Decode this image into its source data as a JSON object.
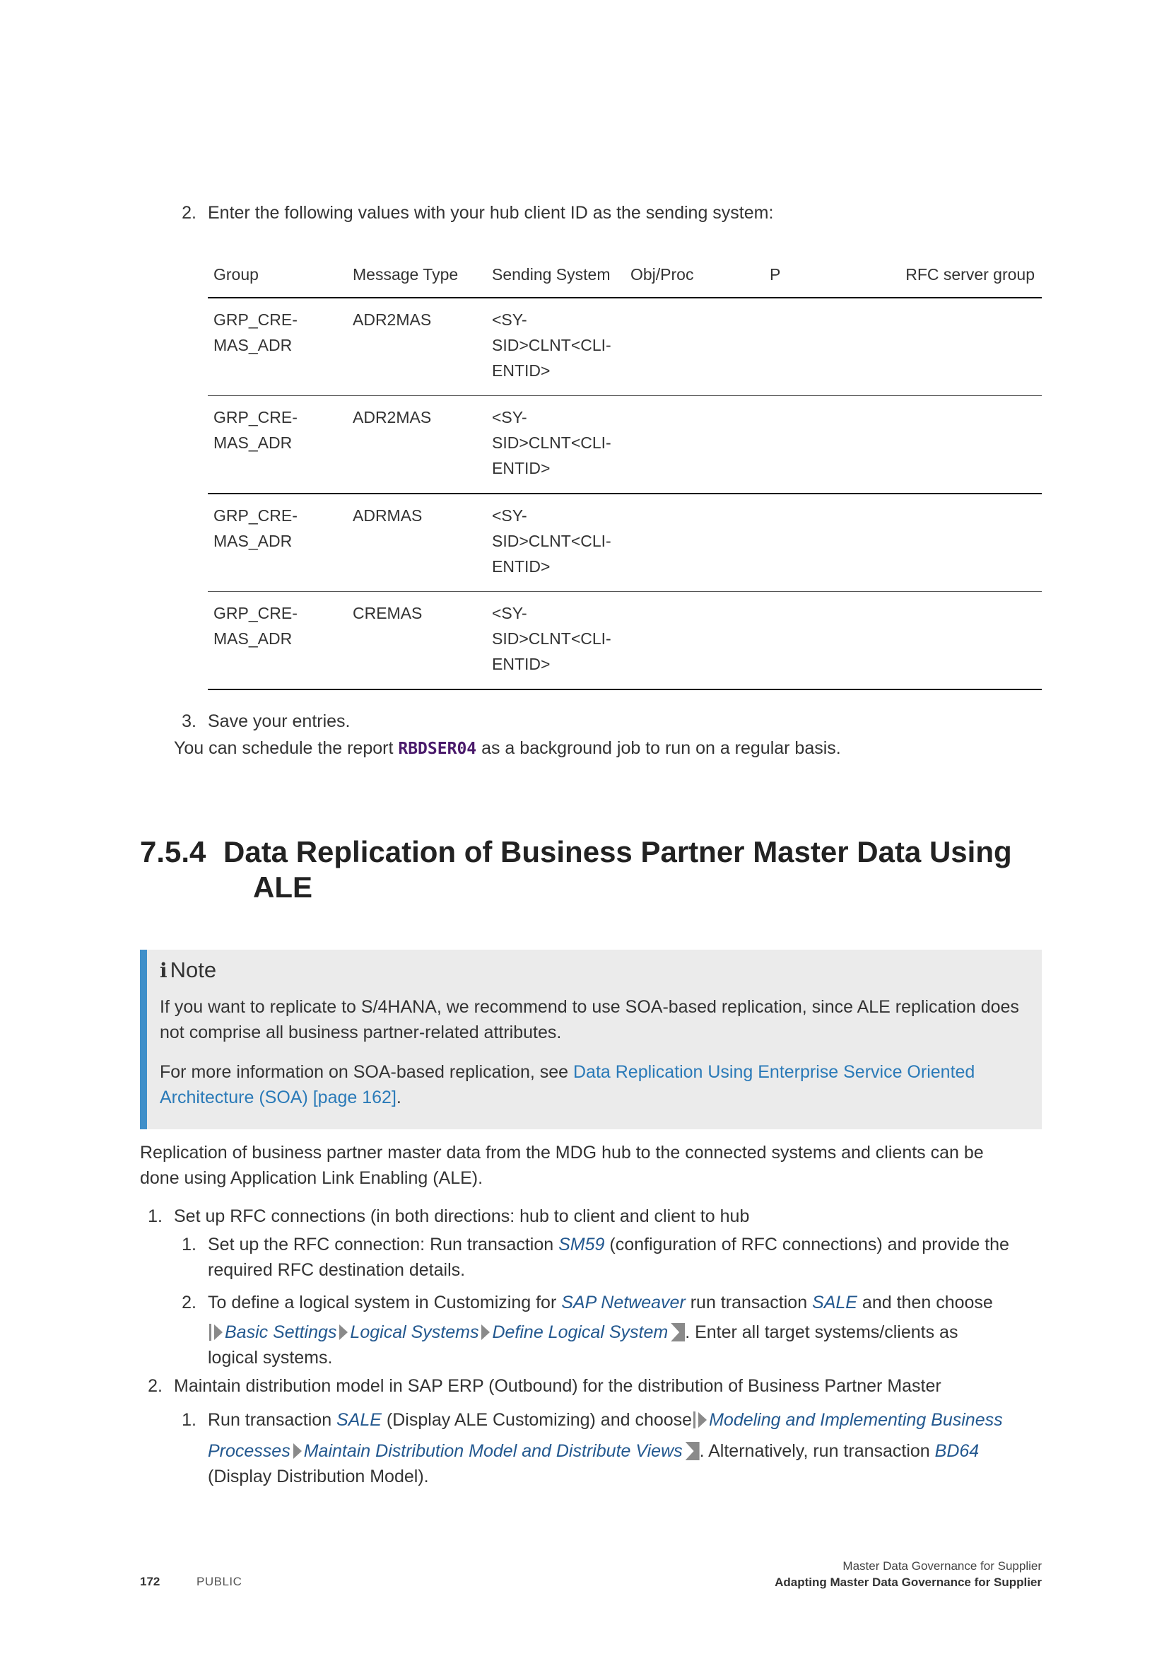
{
  "step2_top": {
    "num": "2.",
    "text": "Enter the following values with your hub client ID as the sending system:"
  },
  "table": {
    "headers": [
      "Group",
      "Message Type",
      "Sending System",
      "Obj/Proc",
      "P",
      "RFC server group"
    ],
    "rows": [
      {
        "group": [
          "GRP_CRE-",
          "MAS_ADR"
        ],
        "message_type": "ADR2MAS",
        "sending_system": [
          "<SY-",
          "SID>CLNT<CLI-",
          "ENTID>"
        ]
      },
      {
        "group": [
          "GRP_CRE-",
          "MAS_ADR"
        ],
        "message_type": "ADR2MAS",
        "sending_system": [
          "<SY-",
          "SID>CLNT<CLI-",
          "ENTID>"
        ]
      },
      {
        "group": [
          "GRP_CRE-",
          "MAS_ADR"
        ],
        "message_type": "ADRMAS",
        "sending_system": [
          "<SY-",
          "SID>CLNT<CLI-",
          "ENTID>"
        ]
      },
      {
        "group": [
          "GRP_CRE-",
          "MAS_ADR"
        ],
        "message_type": "CREMAS",
        "sending_system": [
          "<SY-",
          "SID>CLNT<CLI-",
          "ENTID>"
        ]
      }
    ]
  },
  "step3": {
    "num": "3.",
    "text": "Save your entries."
  },
  "schedule": {
    "before": "You can schedule the report ",
    "code": "RBDSER04",
    "after": " as a background job to run on a regular basis."
  },
  "section": {
    "number": "7.5.4",
    "title_line1": "Data Replication of Business Partner Master Data Using",
    "title_line2": "ALE"
  },
  "note": {
    "icon": "i",
    "title": "Note",
    "p1": "If you want to replicate to S/4HANA, we recommend to use SOA-based replication, since ALE replication does not comprise all business partner-related attributes.",
    "p2_before": "For more information on SOA-based replication, see ",
    "p2_link_line1": "Data Replication Using Enterprise Service Oriented",
    "p2_link_line2": "Architecture (SOA) [page 162]",
    "p2_after": "."
  },
  "intro": {
    "line1": "Replication of business partner master data from the MDG hub to the connected systems and clients can be",
    "line2": "done using Application Link Enabling (ALE)."
  },
  "list": {
    "item1": {
      "num": "1.",
      "text": "Set up RFC connections (in both directions: hub to client and client to hub",
      "sub1": {
        "num": "1.",
        "before": "Set up the RFC connection: Run transaction ",
        "tx": "SM59",
        "after": " (configuration of RFC connections) and provide the",
        "line2": "required RFC destination details."
      },
      "sub2": {
        "num": "2.",
        "before": "To define a logical system in Customizing for ",
        "link1": "SAP Netweaver",
        "mid": " run transaction ",
        "tx": "SALE",
        "after": " and then choose",
        "path": [
          "Basic Settings",
          "Logical Systems",
          "Define Logical System"
        ],
        "after_path": ". Enter all target systems/clients as",
        "line3": "logical systems."
      }
    },
    "item2": {
      "num": "2.",
      "text": "Maintain distribution model in SAP ERP (Outbound) for the distribution of Business Partner Master",
      "sub1": {
        "num": "1.",
        "before": "Run transaction ",
        "tx": "SALE",
        "after": " (Display ALE Customizing) and choose",
        "path1": "Modeling and Implementing Business",
        "path1b": "Processes",
        "path2": "Maintain Distribution Model and Distribute Views",
        "after_path": ". Alternatively, run transaction ",
        "tx2": "BD64",
        "line3": "(Display Distribution Model)."
      }
    }
  },
  "footer": {
    "page": "172",
    "classification": "PUBLIC",
    "doc_title": "Master Data Governance for Supplier",
    "chapter": "Adapting Master Data Governance for Supplier"
  }
}
